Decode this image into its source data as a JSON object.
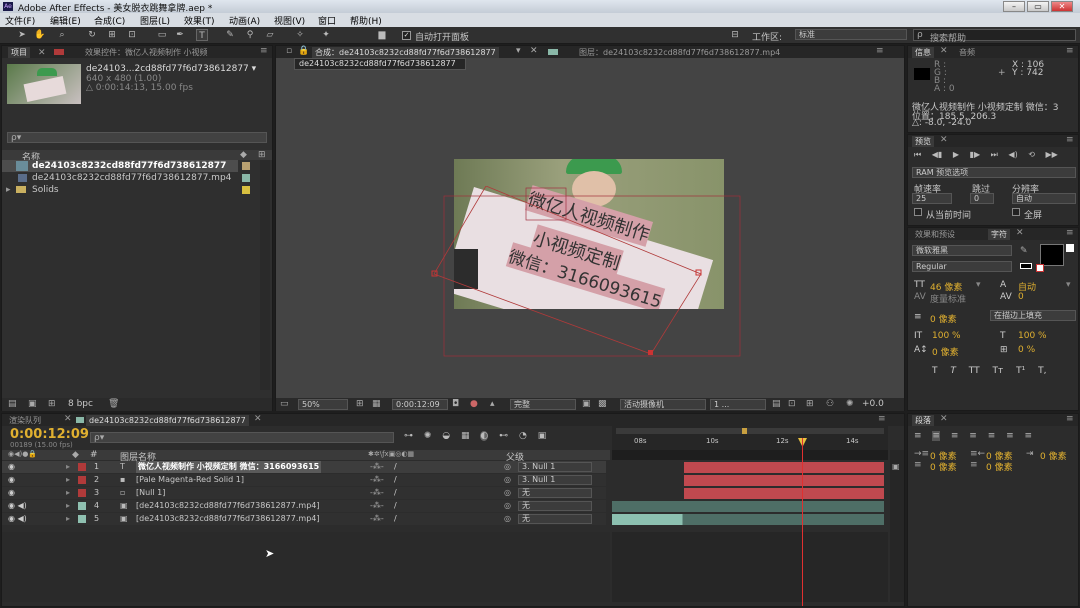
{
  "window": {
    "title": "Adobe After Effects - 美女脱衣跳舞拿牌.aep *",
    "logo": "Ae",
    "min": "–",
    "max": "▭",
    "close": "✕"
  },
  "menu": [
    "文件(F)",
    "编辑(E)",
    "合成(C)",
    "图层(L)",
    "效果(T)",
    "动画(A)",
    "视图(V)",
    "窗口",
    "帮助(H)"
  ],
  "toolbar": {
    "auto_open_label": "自动打开面板",
    "workspace_label": "工作区:",
    "workspace_value": "标准",
    "search_placeholder": "搜索帮助"
  },
  "project": {
    "tab_project": "项目",
    "tab_effects": "效果控件：微亿人视频制作 小视频",
    "item_name": "de24103...2cd88fd77f6d738612877 ▾",
    "item_size": "640 x 480 (1.00)",
    "item_duration": "△ 0:00:14:13, 15.00 fps",
    "search_placeholder": "ρ▾",
    "col_name": "名称",
    "items": [
      "de24103c8232cd88fd77f6d738612877",
      "de24103c8232cd88fd77f6d738612877.mp4",
      "Solids"
    ],
    "bpc": "8 bpc"
  },
  "comp": {
    "tab_comp": "合成：de24103c8232cd88fd77f6d738612877",
    "tab_layer": "图层：de24103c8232cd88fd77f6d738612877.mp4",
    "breadcrumb": "de24103c8232cd88fd77f6d738612877",
    "zoom": "50%",
    "time": "0:00:12:09",
    "quality": "完整",
    "camera": "活动摄像机",
    "views": "1 ...",
    "exposure": "+0.0",
    "sign_lines": [
      "微亿人视频制作",
      "小视频定制",
      "微信：3166093615"
    ]
  },
  "info": {
    "tab_info": "信息",
    "tab_audio": "音频",
    "r": "R :",
    "g": "G :",
    "b": "B :",
    "a": "A : 0",
    "x": "X : 106",
    "y": "Y : 742",
    "layer_text": "微亿人视频制作 小视频定制 微信：3",
    "pos": "位置：185.5, 206.3",
    "delta": "△: -8.0, -24.0"
  },
  "preview": {
    "tab": "预览",
    "ram_options": "RAM 预览选项",
    "fps_label": "帧速率",
    "skip_label": "跳过",
    "res_label": "分辨率",
    "fps": "25",
    "skip": "0",
    "res": "自动",
    "from_current": "从当前时间",
    "fullscreen": "全屏"
  },
  "character": {
    "tab_effects": "效果和预设",
    "tab_char": "字符",
    "font": "微软雅黑",
    "style": "Regular",
    "size": "46 像素",
    "leading": "自动",
    "tracking_label": "度量标准",
    "tracking": "0",
    "stroke": "0 像素",
    "stroke_mode": "在描边上填充",
    "vscale": "100 %",
    "hscale": "100 %",
    "baseline": "0 像素",
    "tsume": "0 %",
    "styles": [
      "T",
      "T",
      "TT",
      "Tт",
      "T¹",
      "T,"
    ]
  },
  "paragraph": {
    "tab": "段落",
    "indent_l": "0 像素",
    "indent_r": "0 像素",
    "space_b": "0 像素",
    "space_a": "0 像素",
    "first": "0 像素"
  },
  "timeline": {
    "tab_render": "渲染队列",
    "tab_comp": "de24103c8232cd88fd77f6d738612877",
    "time": "0:00:12:09",
    "frames": "00189 (15.00 fps)",
    "col_name": "图层名称",
    "col_parent": "父级",
    "ruler": [
      "08s",
      "10s",
      "12s",
      "14s"
    ],
    "layers": [
      {
        "num": "1",
        "color": "#b03a3a",
        "name": "微亿人视频制作 小视频定制 微信：3166093615",
        "parent": "3. Null 1",
        "icon": "T"
      },
      {
        "num": "2",
        "color": "#b03a3a",
        "name": "[Pale Magenta-Red Solid 1]",
        "parent": "3. Null 1",
        "icon": "▪"
      },
      {
        "num": "3",
        "color": "#b03a3a",
        "name": "[Null 1]",
        "parent": "无",
        "icon": "▫"
      },
      {
        "num": "4",
        "color": "#8fc0b0",
        "name": "[de24103c8232cd88fd77f6d738612877.mp4]",
        "parent": "无",
        "icon": "▣"
      },
      {
        "num": "5",
        "color": "#8fc0b0",
        "name": "[de24103c8232cd88fd77f6d738612877.mp4]",
        "parent": "无",
        "icon": "▣"
      }
    ]
  }
}
